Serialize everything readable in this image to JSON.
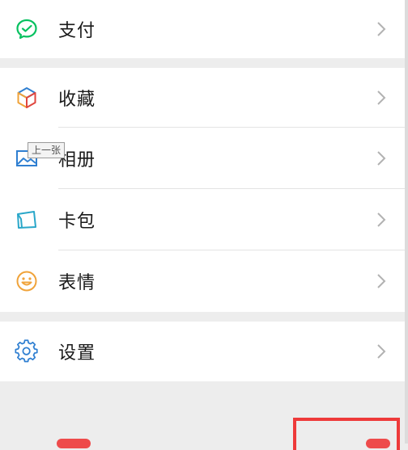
{
  "menu": {
    "pay": {
      "label": "支付",
      "icon": "wechat-pay-icon"
    },
    "favorites": {
      "label": "收藏",
      "icon": "cube-icon"
    },
    "album": {
      "label": "相册",
      "icon": "image-icon"
    },
    "cards": {
      "label": "卡包",
      "icon": "card-icon"
    },
    "stickers": {
      "label": "表情",
      "icon": "smile-icon"
    },
    "settings": {
      "label": "设置",
      "icon": "gear-icon"
    }
  },
  "tooltip": {
    "text": "上一张"
  },
  "colors": {
    "accent_green": "#07c160",
    "accent_blue": "#2f7fd1",
    "accent_orange": "#f0a33a",
    "highlight_red": "#ee3a3a"
  }
}
